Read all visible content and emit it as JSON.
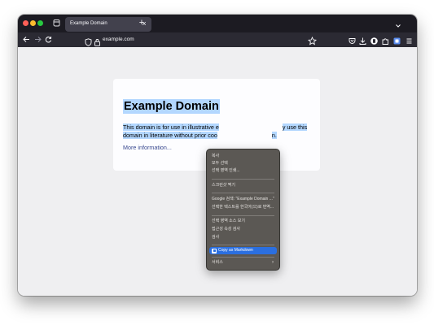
{
  "browser": {
    "tab_title": "Example Domain",
    "tab_close": "×",
    "new_tab": "+",
    "url": "example.com"
  },
  "page": {
    "heading": "Example Domain",
    "paragraph_visible_start": "This domain is for use in illustrative e",
    "paragraph_visible_end": "y use this",
    "paragraph_line2_start": "domain in literature without prior coo",
    "paragraph_line2_end": "n.",
    "more_link": "More information..."
  },
  "context_menu": {
    "items": [
      {
        "label": "복사"
      },
      {
        "label": "모두 선택"
      },
      {
        "label": "선택 영역 인쇄..."
      },
      {
        "label": "스크린샷 찍기"
      },
      {
        "label": "Google 검색: \"Example Domain ...\""
      },
      {
        "label": "선택한 텍스트를 한국어(으)로 번역..."
      },
      {
        "label": "선택 영역 소스 보기"
      },
      {
        "label": "접근성 속성 검사"
      },
      {
        "label": "검사"
      },
      {
        "label": "Copy as Markdown"
      },
      {
        "label": "서비스"
      }
    ],
    "submenu_arrow": "›"
  },
  "colors": {
    "selection": "#b3d7ff",
    "menu_highlight": "#2b6fe0",
    "tabbar": "#1c1b22",
    "navbar": "#2b2a33"
  }
}
